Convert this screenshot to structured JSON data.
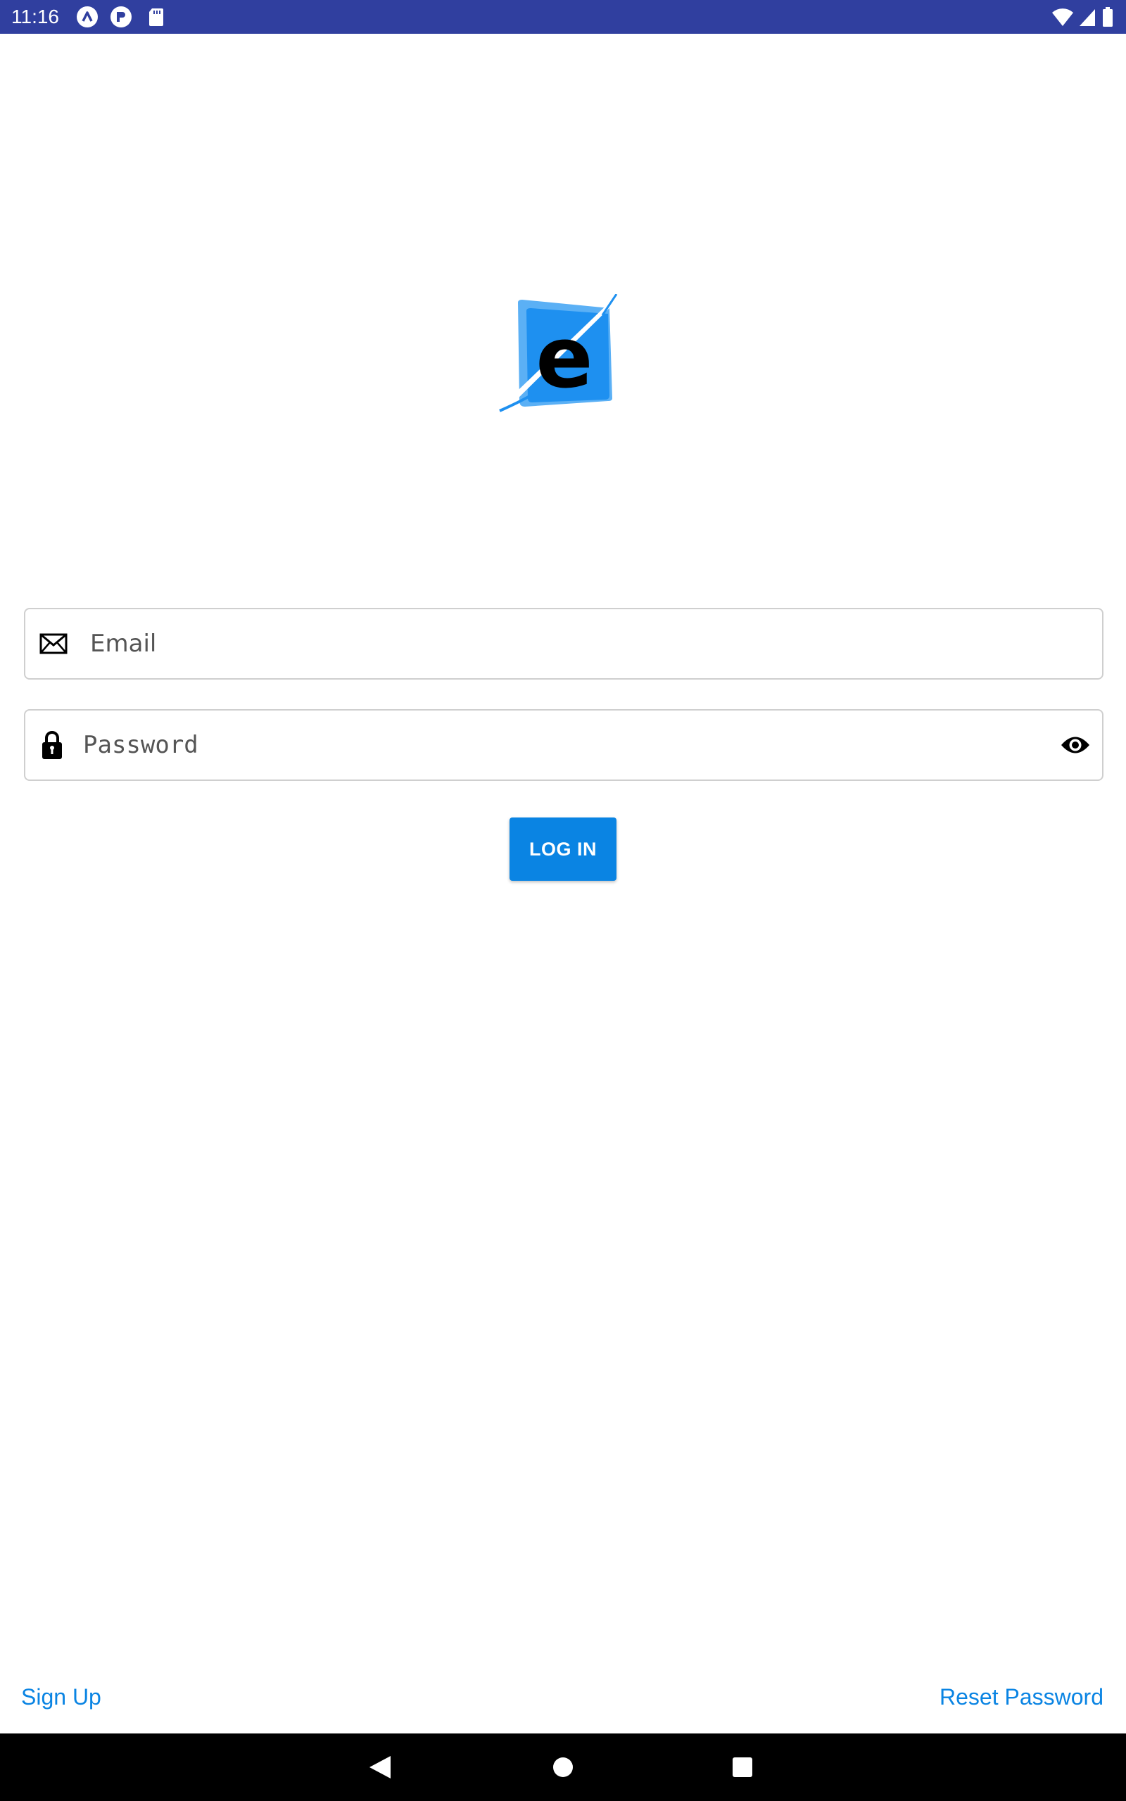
{
  "status_bar": {
    "time": "11:16",
    "notification_icons": [
      "app-a-icon",
      "app-r-icon",
      "sd-card-icon"
    ],
    "system_icons": [
      "wifi-icon",
      "cell-signal-icon",
      "battery-icon"
    ]
  },
  "logo": {
    "letter": "e"
  },
  "email_field": {
    "placeholder": "Email",
    "value": ""
  },
  "password_field": {
    "placeholder": "Password",
    "value": ""
  },
  "login_button": {
    "label": "LOG IN"
  },
  "footer": {
    "signup_label": "Sign Up",
    "reset_label": "Reset Password"
  },
  "navigation": {
    "buttons": [
      "back-icon",
      "home-icon",
      "recents-icon"
    ]
  },
  "colors": {
    "status_bar": "#303f9f",
    "accent": "#0a84e3",
    "logo_blue": "#1e90f0"
  }
}
